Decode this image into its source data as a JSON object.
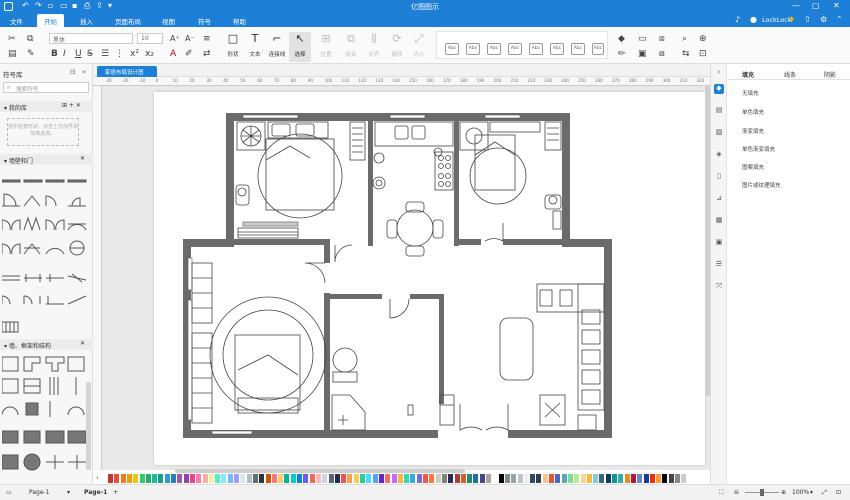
{
  "app": {
    "title": "亿图图示",
    "colors": {
      "accent": "#1e7fd6",
      "wall": "#6b6b6b"
    }
  },
  "menu": {
    "items": [
      "文件",
      "开始",
      "插入",
      "页面布局",
      "视图",
      "符号",
      "帮助"
    ],
    "active": "开始",
    "user": "LockLock",
    "icons": [
      "bell-icon",
      "share-icon",
      "settings-icon",
      "help-icon"
    ]
  },
  "ribbon": {
    "font_family": "黑体",
    "font_size": "10",
    "tools": [
      {
        "label": "形状",
        "icon": "shape-icon",
        "enabled": true,
        "selected": false
      },
      {
        "label": "文本",
        "icon": "text-icon",
        "enabled": true,
        "selected": false
      },
      {
        "label": "连接线",
        "icon": "connector-icon",
        "enabled": true,
        "selected": false
      },
      {
        "label": "选择",
        "icon": "select-icon",
        "enabled": true,
        "selected": true
      },
      {
        "label": "位置",
        "icon": "position-icon",
        "enabled": false,
        "selected": false
      },
      {
        "label": "组合",
        "icon": "group-icon",
        "enabled": false,
        "selected": false
      },
      {
        "label": "对齐",
        "icon": "align-icon",
        "enabled": false,
        "selected": false
      },
      {
        "label": "旋转",
        "icon": "rotate-icon",
        "enabled": false,
        "selected": false
      },
      {
        "label": "大小",
        "icon": "size-icon",
        "enabled": false,
        "selected": false
      }
    ],
    "style_samples": [
      "Abc",
      "Abc",
      "Abc",
      "Abc",
      "Abc",
      "Abc",
      "Abc",
      "Abc"
    ]
  },
  "library": {
    "title": "符号库",
    "search_placeholder": "搜索符号",
    "sections": [
      {
        "label": "我的库",
        "drop_hint": "选中任意形状，点击上方加号添加到此库。"
      },
      {
        "label": "墙壁和门"
      },
      {
        "label": "墙、框架和结构"
      }
    ]
  },
  "document": {
    "tab_label": "家居布局设计图",
    "ruler_marks": [
      "-30",
      "-20",
      "-10",
      "0",
      "10",
      "20",
      "30",
      "40",
      "50",
      "60",
      "70",
      "80",
      "90",
      "100",
      "110",
      "120",
      "130",
      "140",
      "150",
      "160",
      "170",
      "180",
      "190",
      "200",
      "210",
      "220",
      "230",
      "240",
      "250",
      "260",
      "270",
      "280",
      "290",
      "300",
      "310",
      "320"
    ]
  },
  "properties": {
    "tabs": [
      "填充",
      "线条",
      "阴影"
    ],
    "active_tab": "填充",
    "fill_options": [
      "无填充",
      "单色填充",
      "渐变填充",
      "单色渐变填充",
      "图案填充",
      "图片或纹理填充"
    ],
    "side_icons": [
      "fill-icon",
      "text-format-icon",
      "image-icon",
      "layers-icon",
      "page-icon",
      "chart-icon",
      "shape-data-icon",
      "screen-icon",
      "list-icon",
      "expand-icon"
    ]
  },
  "status": {
    "page_selector": "Page-1",
    "current_page": "Page-1",
    "zoom": "100%"
  },
  "palette": [
    "#c0392b",
    "#e74c3c",
    "#e67e22",
    "#f39c12",
    "#f1c40f",
    "#2ecc71",
    "#27ae60",
    "#1abc9c",
    "#16a085",
    "#3498db",
    "#2980b9",
    "#9b59b6",
    "#8e44ad",
    "#e84393",
    "#fd79a8",
    "#fab1a0",
    "#ffeaa7",
    "#55efc4",
    "#81ecec",
    "#74b9ff",
    "#a29bfe",
    "#dfe6e9",
    "#b2bec3",
    "#636e72",
    "#2d3436",
    "#d35400",
    "#ff7675",
    "#fdcb6e",
    "#00b894",
    "#00cec9",
    "#0984e3",
    "#6c5ce7",
    "#e17055",
    "#ffb8b8",
    "#c8d6e5",
    "#576574",
    "#222f3e",
    "#ee5253",
    "#ff9f43",
    "#feca57",
    "#1dd1a1",
    "#48dbfb",
    "#54a0ff",
    "#5f27cd",
    "#ff6b6b",
    "#c56cf0",
    "#ffb142",
    "#33d9b2",
    "#34ace0",
    "#706fd3",
    "#ff5252",
    "#ff793f",
    "#d1ccc0",
    "#84817a",
    "#2c2c54",
    "#b33939",
    "#cd6133",
    "#218c74",
    "#227093",
    "#474787",
    "#aaa69d",
    "#ffffff",
    "#000000",
    "#7f8c8d",
    "#95a5a6",
    "#bdc3c7",
    "#ecf0f1",
    "#34495e",
    "#2c3e50",
    "#f8c291",
    "#e55039",
    "#4a69bd",
    "#60a3bc",
    "#78e08f",
    "#b8e994",
    "#fad390",
    "#f6b93b",
    "#82ccdd",
    "#3c6382",
    "#0a3d62",
    "#079992",
    "#38ada9",
    "#e58e26",
    "#b71540",
    "#6a89cc",
    "#1e3799",
    "#eb2f06",
    "#fa983a",
    "#000000",
    "#444444",
    "#888888",
    "#cccccc",
    "#ffffff"
  ]
}
